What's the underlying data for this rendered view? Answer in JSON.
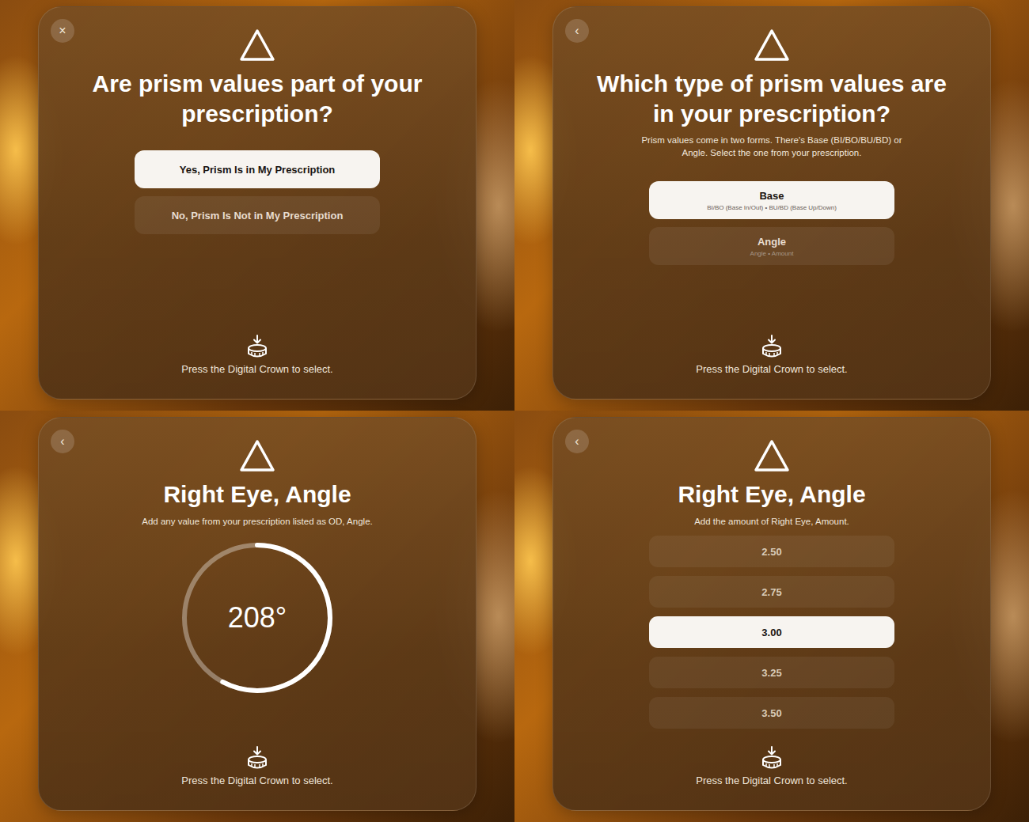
{
  "panels": [
    {
      "kind": "choice",
      "nav": "×",
      "title": "Are prism values part of your prescription?",
      "options": [
        {
          "label": "Yes, Prism Is in My Prescription",
          "selected": true
        },
        {
          "label": "No, Prism Is Not in My Prescription",
          "selected": false
        }
      ],
      "hint": "Press the Digital Crown to select."
    },
    {
      "kind": "choice",
      "nav": "‹",
      "title": "Which type of prism values are in your prescription?",
      "subtitle": "Prism values come in two forms. There's Base (BI/BO/BU/BD) or Angle. Select the one from your prescription.",
      "options": [
        {
          "label": "Base",
          "sub": "BI/BO (Base In/Out) • BU/BD (Base Up/Down)",
          "selected": true
        },
        {
          "label": "Angle",
          "sub": "Angle • Amount",
          "selected": false
        }
      ],
      "hint": "Press the Digital Crown to select."
    },
    {
      "kind": "dial",
      "nav": "‹",
      "title": "Right Eye, Angle",
      "subtitle": "Add any value from your prescription listed as OD, Angle.",
      "dial": {
        "value": "208°",
        "level": 0.578
      },
      "hint": "Press the Digital Crown to select."
    },
    {
      "kind": "picker",
      "nav": "‹",
      "title": "Right Eye, Angle",
      "subtitle": "Add the amount of Right Eye, Amount.",
      "options": [
        {
          "label": "2.50",
          "selected": false
        },
        {
          "label": "2.75",
          "selected": false
        },
        {
          "label": "3.00",
          "selected": true
        },
        {
          "label": "3.25",
          "selected": false
        },
        {
          "label": "3.50",
          "selected": false
        }
      ],
      "hint": "Press the Digital Crown to select."
    }
  ]
}
